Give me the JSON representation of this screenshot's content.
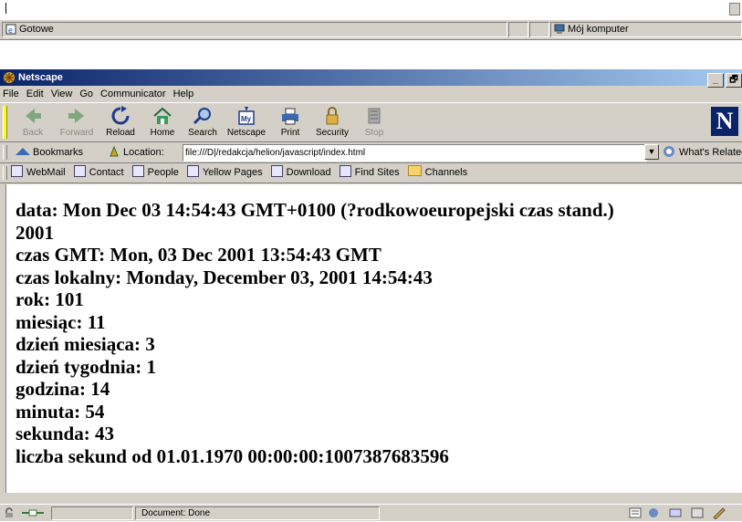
{
  "ie_statusbar": {
    "status_text": "Gotowe",
    "zone_text": "Mój komputer"
  },
  "netscape": {
    "window_title": "Netscape",
    "window_controls": [
      "_",
      "🗗"
    ],
    "menu": [
      "File",
      "Edit",
      "View",
      "Go",
      "Communicator",
      "Help"
    ],
    "toolbar": [
      {
        "label": "Back",
        "icon": "back-arrow-icon",
        "enabled": false
      },
      {
        "label": "Forward",
        "icon": "forward-arrow-icon",
        "enabled": false
      },
      {
        "label": "Reload",
        "icon": "reload-icon",
        "enabled": true
      },
      {
        "label": "Home",
        "icon": "home-icon",
        "enabled": true
      },
      {
        "label": "Search",
        "icon": "search-icon",
        "enabled": true
      },
      {
        "label": "Netscape",
        "icon": "netscape-my-icon",
        "enabled": true
      },
      {
        "label": "Print",
        "icon": "print-icon",
        "enabled": true
      },
      {
        "label": "Security",
        "icon": "security-lock-icon",
        "enabled": true
      },
      {
        "label": "Stop",
        "icon": "stop-icon",
        "enabled": false
      }
    ],
    "logo_letter": "N",
    "location_bar": {
      "bookmarks_label": "Bookmarks",
      "location_label": "Location:",
      "url": "file:///D|/redakcja/helion/javascript/index.html",
      "whats_related_label": "What's Related"
    },
    "personal_toolbar": [
      "WebMail",
      "Contact",
      "People",
      "Yellow Pages",
      "Download",
      "Find Sites",
      "Channels"
    ],
    "content_lines": [
      "data: Mon Dec 03 14:54:43 GMT+0100 (?rodkowoeuropejski czas stand.)",
      "2001",
      "czas GMT: Mon, 03 Dec 2001 13:54:43 GMT",
      "czas lokalny: Monday, December 03, 2001 14:54:43",
      "rok: 101",
      "miesiąc: 11",
      "dzień miesiąca: 3",
      "dzień tygodnia: 1",
      "godzina: 14",
      "minuta: 54",
      "sekunda: 43",
      "liczba sekund od 01.01.1970 00:00:00:1007387683596"
    ],
    "status_bar": {
      "document_status": "Document: Done"
    }
  }
}
